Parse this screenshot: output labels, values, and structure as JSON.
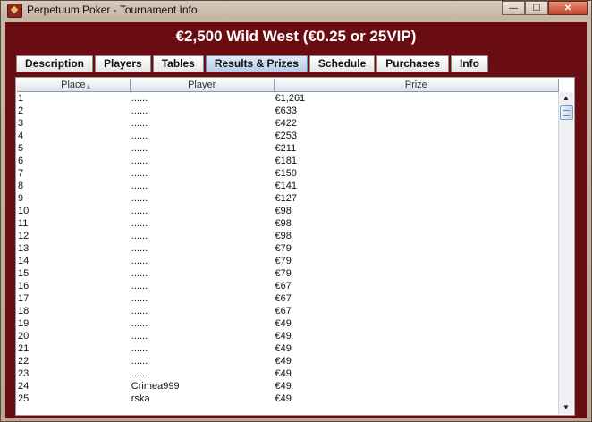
{
  "window": {
    "title": "Perpetuum Poker - Tournament Info",
    "icon": "poker-app-icon",
    "controls": {
      "minimize": "—",
      "maximize": "☐",
      "close": "✕"
    }
  },
  "tournament": {
    "title": "€2,500 Wild West (€0.25 or 25VIP)"
  },
  "tabs": [
    {
      "label": "Description",
      "active": false
    },
    {
      "label": "Players",
      "active": false
    },
    {
      "label": "Tables",
      "active": false
    },
    {
      "label": "Results & Prizes",
      "active": true
    },
    {
      "label": "Schedule",
      "active": false
    },
    {
      "label": "Purchases",
      "active": false
    },
    {
      "label": "Info",
      "active": false
    }
  ],
  "table": {
    "columns": [
      "Place",
      "Player",
      "Prize"
    ],
    "sort_indicator": "▲",
    "rows": [
      [
        "1",
        "......",
        "€1,261"
      ],
      [
        "2",
        "......",
        "€633"
      ],
      [
        "3",
        "......",
        "€422"
      ],
      [
        "4",
        "......",
        "€253"
      ],
      [
        "5",
        "......",
        "€211"
      ],
      [
        "6",
        "......",
        "€181"
      ],
      [
        "7",
        "......",
        "€159"
      ],
      [
        "8",
        "......",
        "€141"
      ],
      [
        "9",
        "......",
        "€127"
      ],
      [
        "10",
        "......",
        "€98"
      ],
      [
        "11",
        "......",
        "€98"
      ],
      [
        "12",
        "......",
        "€98"
      ],
      [
        "13",
        "......",
        "€79"
      ],
      [
        "14",
        "......",
        "€79"
      ],
      [
        "15",
        "......",
        "€79"
      ],
      [
        "16",
        "......",
        "€67"
      ],
      [
        "17",
        "......",
        "€67"
      ],
      [
        "18",
        "......",
        "€67"
      ],
      [
        "19",
        "......",
        "€49"
      ],
      [
        "20",
        "......",
        "€49"
      ],
      [
        "21",
        "......",
        "€49"
      ],
      [
        "22",
        "......",
        "€49"
      ],
      [
        "23",
        "......",
        "€49"
      ],
      [
        "24",
        "Crimea999",
        "€49"
      ],
      [
        "25",
        "rska",
        "€49"
      ]
    ]
  },
  "scrollbar": {
    "up": "▲",
    "down": "▼"
  },
  "colors": {
    "frame": "#6a0d12",
    "active_tab": "#b7cbe6",
    "window_chrome": "#c3b3a2"
  }
}
